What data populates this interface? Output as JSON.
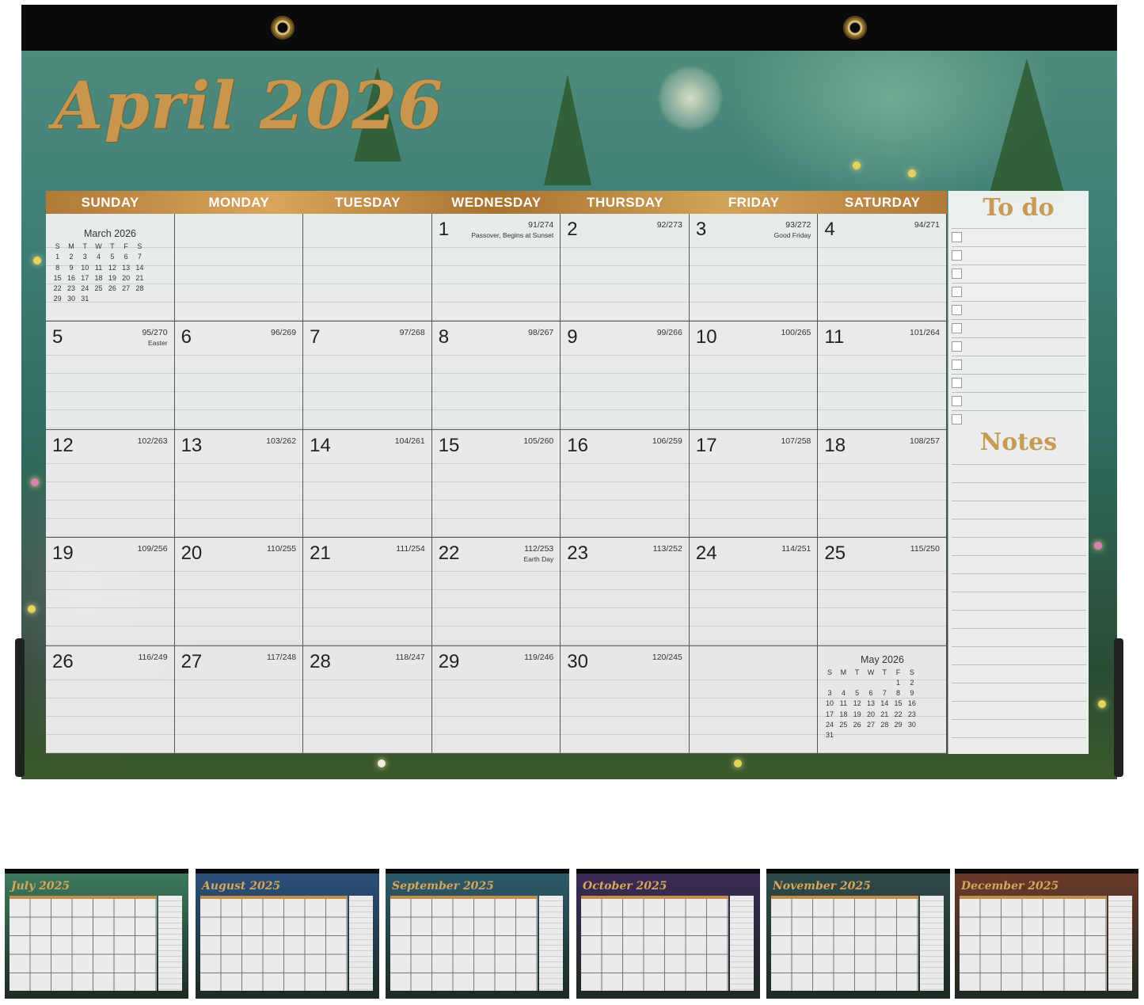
{
  "main": {
    "title": "April 2026",
    "weekdays": [
      "SUNDAY",
      "MONDAY",
      "TUESDAY",
      "WEDNESDAY",
      "THURSDAY",
      "FRIDAY",
      "SATURDAY"
    ],
    "todo_title": "To do",
    "notes_title": "Notes",
    "days": [
      {
        "day": "1",
        "index": "91/274",
        "note": "Passover, Begins at Sunset"
      },
      {
        "day": "2",
        "index": "92/273",
        "note": ""
      },
      {
        "day": "3",
        "index": "93/272",
        "note": "Good Friday"
      },
      {
        "day": "4",
        "index": "94/271",
        "note": ""
      },
      {
        "day": "5",
        "index": "95/270",
        "note": "Easter"
      },
      {
        "day": "6",
        "index": "96/269",
        "note": ""
      },
      {
        "day": "7",
        "index": "97/268",
        "note": ""
      },
      {
        "day": "8",
        "index": "98/267",
        "note": ""
      },
      {
        "day": "9",
        "index": "99/266",
        "note": ""
      },
      {
        "day": "10",
        "index": "100/265",
        "note": ""
      },
      {
        "day": "11",
        "index": "101/264",
        "note": ""
      },
      {
        "day": "12",
        "index": "102/263",
        "note": ""
      },
      {
        "day": "13",
        "index": "103/262",
        "note": ""
      },
      {
        "day": "14",
        "index": "104/261",
        "note": ""
      },
      {
        "day": "15",
        "index": "105/260",
        "note": ""
      },
      {
        "day": "16",
        "index": "106/259",
        "note": ""
      },
      {
        "day": "17",
        "index": "107/258",
        "note": ""
      },
      {
        "day": "18",
        "index": "108/257",
        "note": ""
      },
      {
        "day": "19",
        "index": "109/256",
        "note": ""
      },
      {
        "day": "20",
        "index": "110/255",
        "note": ""
      },
      {
        "day": "21",
        "index": "111/254",
        "note": ""
      },
      {
        "day": "22",
        "index": "112/253",
        "note": "Earth Day"
      },
      {
        "day": "23",
        "index": "113/252",
        "note": ""
      },
      {
        "day": "24",
        "index": "114/251",
        "note": ""
      },
      {
        "day": "25",
        "index": "115/250",
        "note": ""
      },
      {
        "day": "26",
        "index": "116/249",
        "note": ""
      },
      {
        "day": "27",
        "index": "117/248",
        "note": ""
      },
      {
        "day": "28",
        "index": "118/247",
        "note": ""
      },
      {
        "day": "29",
        "index": "119/246",
        "note": ""
      },
      {
        "day": "30",
        "index": "120/245",
        "note": ""
      }
    ],
    "mini_prev": {
      "title": "March 2026",
      "header": [
        "S",
        "M",
        "T",
        "W",
        "T",
        "F",
        "S"
      ],
      "rows": [
        [
          "1",
          "2",
          "3",
          "4",
          "5",
          "6",
          "7"
        ],
        [
          "8",
          "9",
          "10",
          "11",
          "12",
          "13",
          "14"
        ],
        [
          "15",
          "16",
          "17",
          "18",
          "19",
          "20",
          "21"
        ],
        [
          "22",
          "23",
          "24",
          "25",
          "26",
          "27",
          "28"
        ],
        [
          "29",
          "30",
          "31",
          "",
          "",
          "",
          ""
        ]
      ]
    },
    "mini_next": {
      "title": "May 2026",
      "header": [
        "S",
        "M",
        "T",
        "W",
        "T",
        "F",
        "S"
      ],
      "rows": [
        [
          "",
          "",
          "",
          "",
          "",
          "1",
          "2"
        ],
        [
          "3",
          "4",
          "5",
          "6",
          "7",
          "8",
          "9"
        ],
        [
          "10",
          "11",
          "12",
          "13",
          "14",
          "15",
          "16"
        ],
        [
          "17",
          "18",
          "19",
          "20",
          "21",
          "22",
          "23"
        ],
        [
          "24",
          "25",
          "26",
          "27",
          "28",
          "29",
          "30"
        ],
        [
          "31",
          "",
          "",
          "",
          "",
          "",
          ""
        ]
      ]
    }
  },
  "thumbnails": [
    {
      "name": "July 2025",
      "accent": "#3d7a5c"
    },
    {
      "name": "August 2025",
      "accent": "#2a4f7a"
    },
    {
      "name": "September 2025",
      "accent": "#2d5b6a"
    },
    {
      "name": "October 2025",
      "accent": "#3a2a55"
    },
    {
      "name": "November 2025",
      "accent": "#2f4a4a"
    },
    {
      "name": "December 2025",
      "accent": "#6a3a2a"
    }
  ],
  "colors": {
    "gold": "#c79a55",
    "header_gold": "#c08e4a",
    "frame": "#0a0a0a"
  }
}
